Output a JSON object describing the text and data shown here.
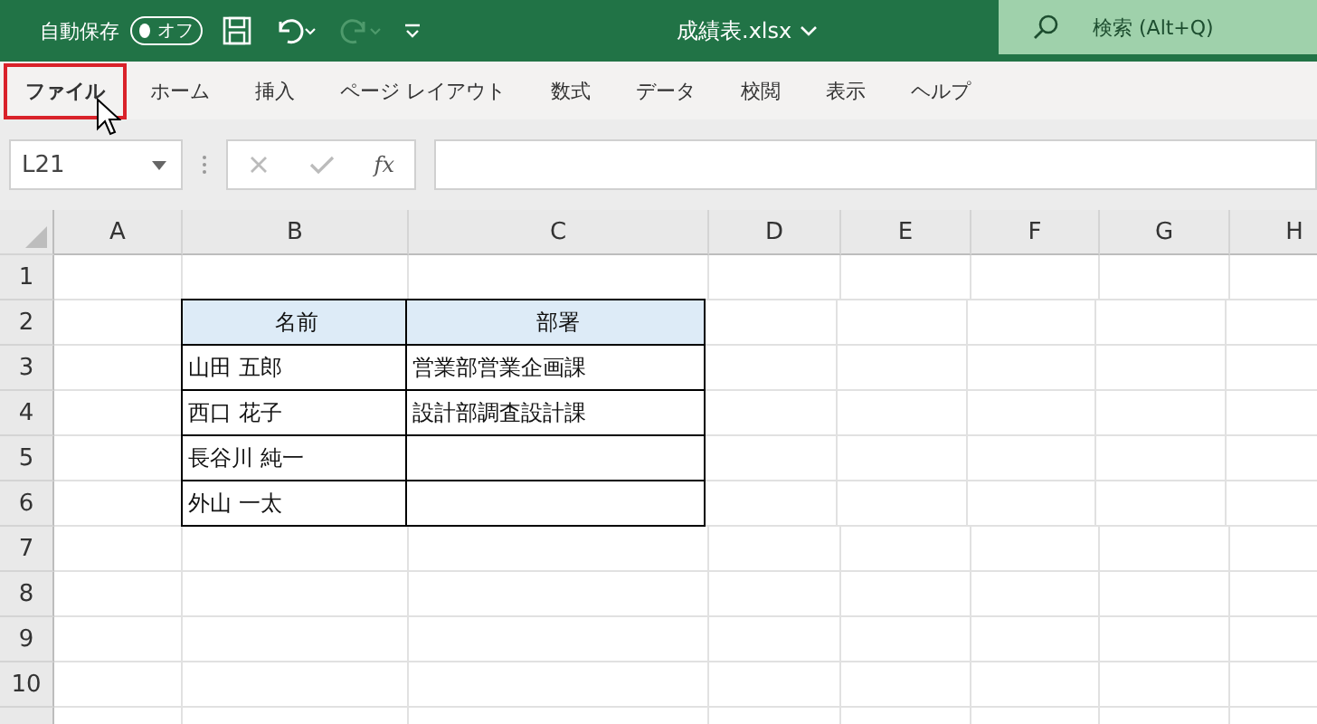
{
  "title_bar": {
    "autosave_label": "自動保存",
    "autosave_toggle": {
      "label": "オフ",
      "on": false
    },
    "filename": "成績表.xlsx",
    "search_placeholder": "検索 (Alt+Q)"
  },
  "ribbon_tabs": [
    {
      "label": "ファイル",
      "selected": true
    },
    {
      "label": "ホーム",
      "selected": false
    },
    {
      "label": "挿入",
      "selected": false
    },
    {
      "label": "ページ レイアウト",
      "selected": false
    },
    {
      "label": "数式",
      "selected": false
    },
    {
      "label": "データ",
      "selected": false
    },
    {
      "label": "校閲",
      "selected": false
    },
    {
      "label": "表示",
      "selected": false
    },
    {
      "label": "ヘルプ",
      "selected": false
    }
  ],
  "formula_bar": {
    "name_box": "L21",
    "fx": "fx"
  },
  "sheet": {
    "columns": [
      "A",
      "B",
      "C",
      "D",
      "E",
      "F",
      "G",
      "H"
    ],
    "rows": [
      {
        "number": "1",
        "cells": [
          {
            "kind": "plain"
          },
          {
            "kind": "plain"
          },
          {
            "kind": "plain"
          }
        ]
      },
      {
        "number": "2",
        "cells": [
          {
            "kind": "plain"
          },
          {
            "kind": "head",
            "text": "名前"
          },
          {
            "kind": "head",
            "text": "部署"
          }
        ]
      },
      {
        "number": "3",
        "cells": [
          {
            "kind": "plain"
          },
          {
            "kind": "box",
            "text": "山田 五郎"
          },
          {
            "kind": "box",
            "text": "営業部営業企画課"
          }
        ]
      },
      {
        "number": "4",
        "cells": [
          {
            "kind": "plain"
          },
          {
            "kind": "box",
            "text": "西口 花子"
          },
          {
            "kind": "box",
            "text": "設計部調査設計課"
          }
        ]
      },
      {
        "number": "5",
        "cells": [
          {
            "kind": "plain"
          },
          {
            "kind": "box",
            "text": "長谷川 純一"
          },
          {
            "kind": "box"
          }
        ]
      },
      {
        "number": "6",
        "cells": [
          {
            "kind": "plain"
          },
          {
            "kind": "box",
            "text": "外山 一太"
          },
          {
            "kind": "box"
          }
        ]
      },
      {
        "number": "7",
        "cells": []
      },
      {
        "number": "8",
        "cells": []
      },
      {
        "number": "9",
        "cells": []
      },
      {
        "number": "10",
        "cells": []
      }
    ]
  }
}
